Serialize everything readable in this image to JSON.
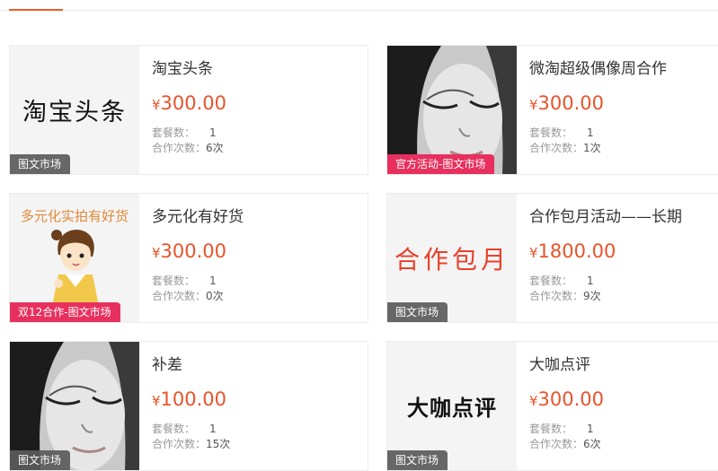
{
  "labels": {
    "currency": "¥",
    "package_count": "套餐数：",
    "cooperation_count": "合作次数："
  },
  "colors": {
    "accent": "#ee5a2c",
    "price": "#e8542a",
    "tag_gray": "#5a5a5a",
    "tag_pink": "#e8305e"
  },
  "cards": [
    {
      "title": "淘宝头条",
      "price": "300.00",
      "packages": "1",
      "cooperations": "6次",
      "tag": "图文市场",
      "thumb_text": "淘宝头条"
    },
    {
      "title": "微淘超级偶像周合作",
      "price": "300.00",
      "packages": "1",
      "cooperations": "1次",
      "tag": "官方活动-图文市场",
      "thumb_icon": "portrait-photo-icon"
    },
    {
      "title": "多元化有好货",
      "price": "300.00",
      "packages": "1",
      "cooperations": "0次",
      "tag": "双12合作-图文市场",
      "thumb_text": "多元化实拍有好货",
      "thumb_icon": "cartoon-girl-icon"
    },
    {
      "title": "合作包月活动——长期",
      "price": "1800.00",
      "packages": "1",
      "cooperations": "9次",
      "tag": "图文市场",
      "thumb_text": "合作包月"
    },
    {
      "title": "补差",
      "price": "100.00",
      "packages": "1",
      "cooperations": "15次",
      "tag": "图文市场",
      "thumb_icon": "portrait-photo-icon"
    },
    {
      "title": "大咖点评",
      "price": "300.00",
      "packages": "1",
      "cooperations": "6次",
      "tag": "图文市场",
      "thumb_text": "大咖点评"
    }
  ]
}
